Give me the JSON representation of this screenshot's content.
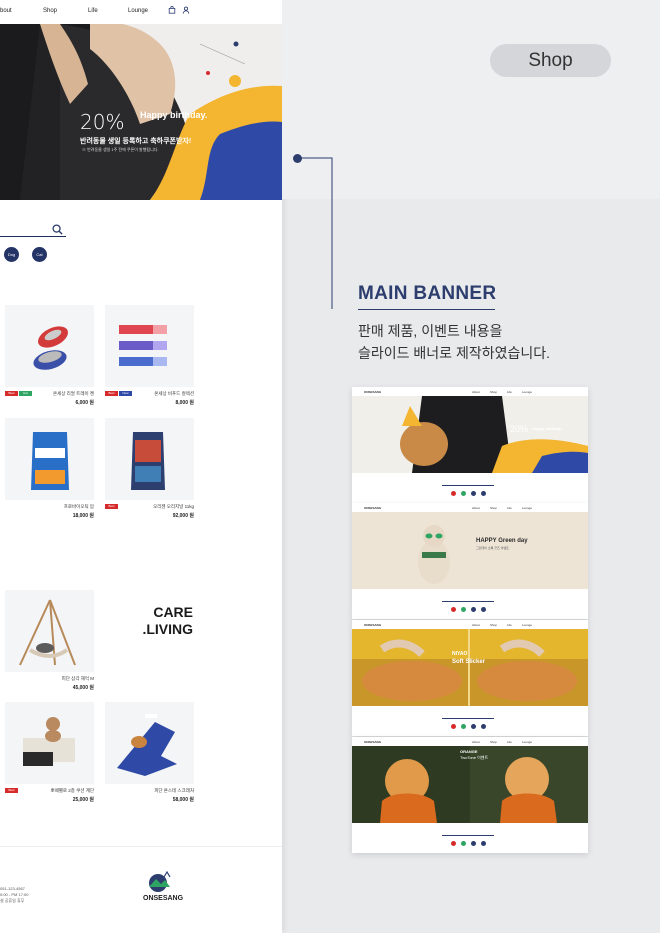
{
  "nav": {
    "items": [
      "bout",
      "Shop",
      "Life",
      "Lounge"
    ]
  },
  "hero": {
    "percent": "20%",
    "headline": "Happy birthday.",
    "subline": "반려동물 생일 등록하고 축하쿠폰받자!",
    "note": "※ 반려동물 생일 1주 전에 쿠폰이 발행됩니다."
  },
  "categories": [
    "Dog",
    "Cat"
  ],
  "products_row1": [
    {
      "name": "온세상 리얼 트레이 켄",
      "price": "6,000 원",
      "badges": [
        "Best",
        "Hot"
      ]
    },
    {
      "name": "온세상 비푸드 컬렉션",
      "price": "8,000 원",
      "badges": [
        "Best",
        "New"
      ]
    }
  ],
  "products_row2": [
    {
      "name": "프로바이오틱 맘",
      "price": "18,000 원",
      "badges": []
    },
    {
      "name": "오리젠 오리지널 11kg",
      "price": "92,000 원",
      "badges": [
        "Best"
      ]
    }
  ],
  "care_living": {
    "line1": "CARE",
    "line2": ".LIVING"
  },
  "products_row3": [
    {
      "name": "피단 삼각 해먹 M",
      "price": "45,000 원"
    }
  ],
  "products_row4": [
    {
      "name": "뽀떼펠로 2층 쿠션 계단",
      "price": "25,000 원",
      "badges": [
        "Best"
      ]
    },
    {
      "name": "피단 욘스테 스크래처",
      "price": "58,000 원",
      "badges": []
    }
  ],
  "footer": {
    "lines": [
      "051-123-4567",
      "0:00 - PM 17:00",
      "설 공휴일 휴무"
    ],
    "brand": "ONSESANG"
  },
  "panel": {
    "section_pill": "Shop",
    "title": "MAIN BANNER",
    "desc_line1": "판매 제품, 이벤트 내용을",
    "desc_line2": "슬라이드 배너로 제작하였습니다."
  },
  "previews": [
    {
      "caption_big": "20%",
      "caption_small": "Happy birthday."
    },
    {
      "caption_big": "HAPPY Green day",
      "caption_small": "그린데이 초록 굿즈 이벤트"
    },
    {
      "caption_big": "NIYAO",
      "caption_small": "Soft Slicker"
    },
    {
      "caption_big": "ORANGE",
      "caption_small": "TwoTone 이벤트"
    }
  ],
  "preview_nav": [
    "About",
    "Shop",
    "Life",
    "Lounge"
  ],
  "preview_brand": "ONSESANG",
  "colors": {
    "navy": "#2c3d6e",
    "yellow": "#f4b531",
    "blue": "#2f4aa6",
    "red": "#d72b2b",
    "green": "#2fa564"
  }
}
